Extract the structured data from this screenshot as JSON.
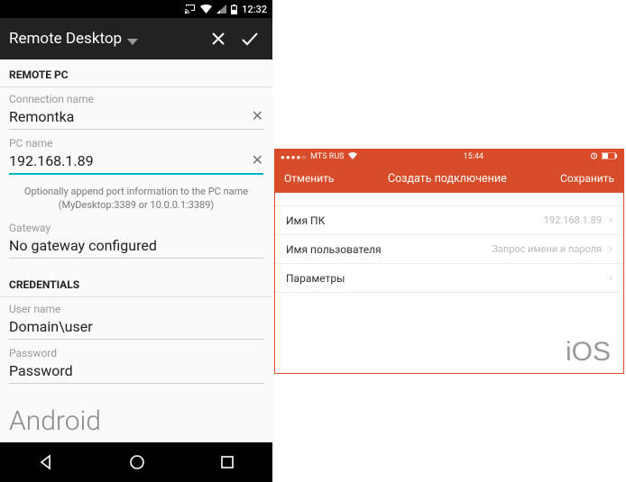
{
  "android": {
    "status_time": "12:32",
    "header_title": "Remote Desktop",
    "sections": {
      "remote_pc": "REMOTE PC",
      "credentials": "CREDENTIALS"
    },
    "fields": {
      "conn_label": "Connection name",
      "conn_value": "Remontka",
      "pc_label": "PC name",
      "pc_value": "192.168.1.89",
      "pc_hint": "Optionally append port information to the PC name (MyDesktop:3389 or 10.0.0.1:3389)",
      "gw_label": "Gateway",
      "gw_value": "No gateway configured",
      "user_label": "User name",
      "user_placeholder": "Domain\\user",
      "pass_label": "Password",
      "pass_placeholder": "Password"
    },
    "platform_label": "Android"
  },
  "ios": {
    "carrier": "MTS RUS",
    "time": "15:44",
    "header": {
      "cancel": "Отменить",
      "title": "Создать подключение",
      "save": "Сохранить"
    },
    "rows": {
      "pc_label": "Имя ПК",
      "pc_value": "192.168.1.89",
      "user_label": "Имя пользователя",
      "user_value": "Запрос имени и пароля",
      "params_label": "Параметры"
    },
    "platform_label": "iOS"
  }
}
